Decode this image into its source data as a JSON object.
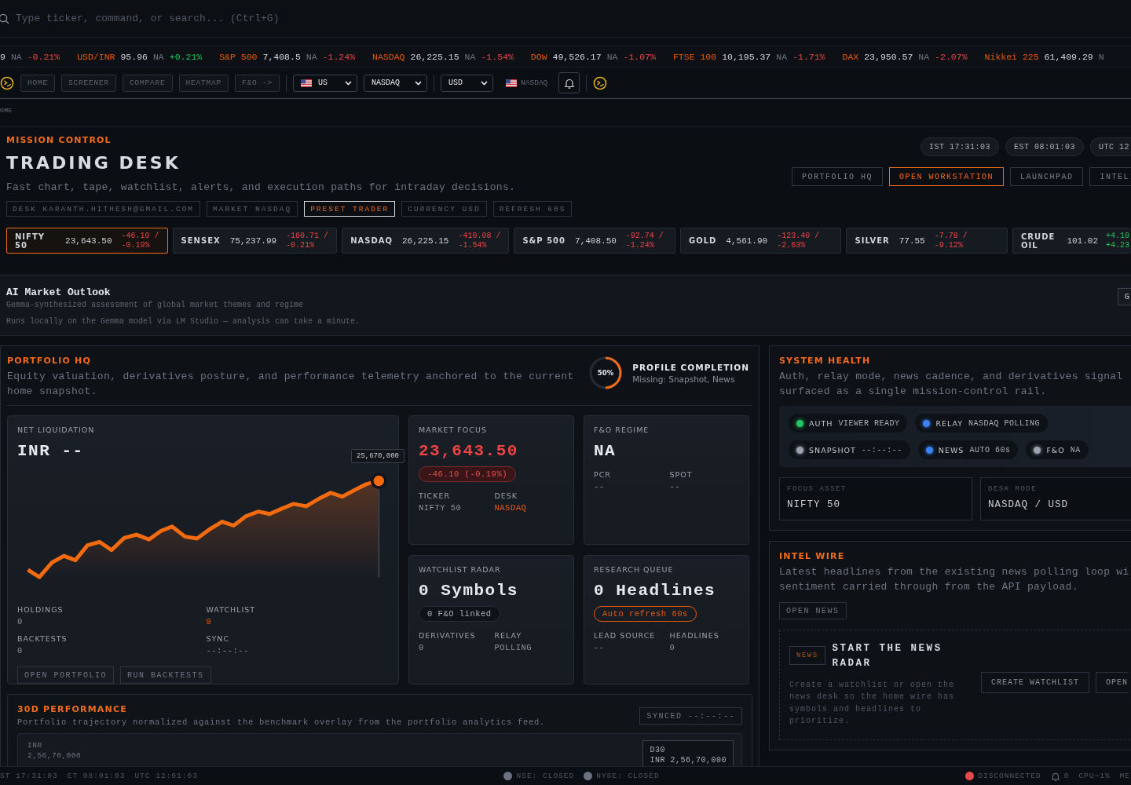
{
  "search": {
    "placeholder": "Type ticker, command, or search... (Ctrl+G)"
  },
  "ticker_tape": [
    {
      "price": "9",
      "source": "NA",
      "change": "-0.21%",
      "negative": true
    },
    {
      "symbol": "USD/INR",
      "price": "95.96",
      "source": "NA",
      "change": "+0.21%",
      "negative": false
    },
    {
      "symbol": "S&P 500",
      "price": "7,408.5",
      "source": "NA",
      "change": "-1.24%",
      "negative": true
    },
    {
      "symbol": "NASDAQ",
      "price": "26,225.15",
      "source": "NA",
      "change": "-1.54%",
      "negative": true
    },
    {
      "symbol": "DOW",
      "price": "49,526.17",
      "source": "NA",
      "change": "-1.07%",
      "negative": true
    },
    {
      "symbol": "FTSE 100",
      "price": "10,195.37",
      "source": "NA",
      "change": "-1.71%",
      "negative": true
    },
    {
      "symbol": "DAX",
      "price": "23,950.57",
      "source": "NA",
      "change": "-2.07%",
      "negative": true
    },
    {
      "symbol": "Nikkei 225",
      "price": "61,409.29",
      "source": "N"
    }
  ],
  "nav": {
    "buttons": [
      "HOME",
      "SCREENER",
      "COMPARE",
      "HEATMAP",
      "F&O ->"
    ],
    "region_select": "US",
    "exchange_select": "NASDAQ",
    "currency_select": "USD",
    "market_chip": "NASDAQ"
  },
  "breadcrumb": "OME",
  "header": {
    "eyebrow": "MISSION CONTROL",
    "title": "TRADING DESK",
    "subtitle": "Fast chart, tape, watchlist, alerts, and execution paths for intraday decisions.",
    "chips": [
      {
        "label": "DESK KARANTH.HITHESH@GMAIL.COM",
        "selected": false
      },
      {
        "label": "MARKET NASDAQ",
        "selected": false
      },
      {
        "label": "PRESET TRADER",
        "selected": true
      },
      {
        "label": "CURRENCY USD",
        "selected": false
      },
      {
        "label": "REFRESH 60S",
        "selected": false
      }
    ],
    "clocks": [
      "IST 17:31:03",
      "EST 08:01:03",
      "UTC 12"
    ],
    "links": [
      {
        "label": "PORTFOLIO HQ",
        "selected": false
      },
      {
        "label": "OPEN WORKSTATION",
        "selected": true
      },
      {
        "label": "LAUNCHPAD",
        "selected": false
      },
      {
        "label": "INTEL",
        "selected": false
      }
    ],
    "indices": [
      {
        "name": "NIFTY 50",
        "price": "23,643.50",
        "change": "-46.10 /",
        "percent": "-0.19%",
        "negative": true,
        "selected": true
      },
      {
        "name": "SENSEX",
        "price": "75,237.99",
        "change": "-160.71 /",
        "percent": "-0.21%",
        "negative": true,
        "selected": false
      },
      {
        "name": "NASDAQ",
        "price": "26,225.15",
        "change": "-410.08 /",
        "percent": "-1.54%",
        "negative": true,
        "selected": false
      },
      {
        "name": "S&P 500",
        "price": "7,408.50",
        "change": "-92.74 /",
        "percent": "-1.24%",
        "negative": true,
        "selected": false
      },
      {
        "name": "GOLD",
        "price": "4,561.90",
        "change": "-123.40 /",
        "percent": "-2.63%",
        "negative": true,
        "selected": false
      },
      {
        "name": "SILVER",
        "price": "77.55",
        "change": "-7.78 /",
        "percent": "-9.12%",
        "negative": true,
        "selected": false
      },
      {
        "name": "CRUDE OIL",
        "price": "101.02",
        "change": "+4.10",
        "percent": "+4.23",
        "negative": false,
        "selected": false
      }
    ]
  },
  "outlook": {
    "title": "AI Market Outlook",
    "subtitle": "Gemma-synthesized assessment of global market themes and regime",
    "note": "Runs locally on the Gemma model via LM Studio — analysis can take a minute.",
    "button": "G"
  },
  "portfolio": {
    "eyebrow": "PORTFOLIO HQ",
    "description": "Equity valuation, derivatives posture, and performance telemetry anchored to the current\nhome snapshot.",
    "profile": {
      "level": 0.5,
      "percent": "50%",
      "title": "PROFILE COMPLETION",
      "missing": "Missing: Snapshot, News"
    },
    "net_liquidation": {
      "label": "NET LIQUIDATION",
      "value": "INR --",
      "tooltip": "25,670,000",
      "stats": [
        {
          "label": "HOLDINGS",
          "value": "0",
          "accent": false
        },
        {
          "label": "WATCHLIST",
          "value": "0",
          "accent": true
        },
        {
          "label": "BACKTESTS",
          "value": "0",
          "accent": false
        },
        {
          "label": "SYNC",
          "value": "--:--:--",
          "accent": false
        }
      ],
      "buttons": [
        "OPEN PORTFOLIO",
        "RUN BACKTESTS"
      ]
    },
    "cards": [
      {
        "label": "MARKET FOCUS",
        "value": "23,643.50",
        "negative": true,
        "pill": {
          "text": "-46.10 (-0.19%)",
          "kind": "negative"
        },
        "stats": [
          {
            "label": "TICKER",
            "value": "NIFTY 50",
            "accent": false
          },
          {
            "label": "DESK",
            "value": "NASDAQ",
            "accent": true
          }
        ]
      },
      {
        "label": "F&O REGIME",
        "value": "NA",
        "stats": [
          {
            "label": "PCR",
            "value": "--",
            "accent": false
          },
          {
            "label": "SPOT",
            "value": "--",
            "accent": false
          }
        ]
      },
      {
        "label": "WATCHLIST RADAR",
        "value": "0 Symbols",
        "pill": {
          "text": "0 F&O linked",
          "kind": "neutral"
        },
        "stats": [
          {
            "label": "DERIVATIVES",
            "value": "0",
            "accent": false
          },
          {
            "label": "RELAY",
            "value": "POLLING",
            "accent": false
          }
        ]
      },
      {
        "label": "RESEARCH QUEUE",
        "value": "0 Headlines",
        "pill": {
          "text": "Auto refresh 60s",
          "kind": "accent"
        },
        "stats": [
          {
            "label": "LEAD SOURCE",
            "value": "--",
            "accent": false
          },
          {
            "label": "HEADLINES",
            "value": "0",
            "accent": false
          }
        ]
      }
    ],
    "performance": {
      "eyebrow": "30D PERFORMANCE",
      "description": "Portfolio trajectory normalized against the benchmark overlay from the portfolio analytics feed.",
      "synced": "SYNCED --:--:--",
      "axis_label": "INR",
      "axis_value": "2,56,70,000",
      "tag_title": "D30",
      "tag_value": "INR 2,56,70,000"
    }
  },
  "system_health": {
    "eyebrow": "SYSTEM HEALTH",
    "description": "Auth, relay mode, news cadence, and derivatives signal\nsurfaced as a single mission-control rail.",
    "pills": [
      {
        "label": "AUTH",
        "value": "VIEWER READY",
        "color": "#22c55e"
      },
      {
        "label": "RELAY",
        "value": "NASDAQ POLLING",
        "color": "#3b82f6"
      },
      {
        "label": "SNAPSHOT",
        "value": "--:--:--",
        "color": "#9ca3af"
      },
      {
        "label": "NEWS",
        "value": "AUTO 60s",
        "color": "#3b82f6"
      },
      {
        "label": "F&O",
        "value": "NA",
        "color": "#9ca3af"
      }
    ],
    "fields": [
      {
        "label": "FOCUS ASSET",
        "value": "NIFTY 50"
      },
      {
        "label": "DESK MODE",
        "value": "NASDAQ / USD"
      }
    ]
  },
  "intel_wire": {
    "eyebrow": "INTEL WIRE",
    "description": "Latest headlines from the existing news polling loop wi\nsentiment carried through from the API payload.",
    "button": "OPEN NEWS",
    "empty_state": {
      "tag": "NEWS",
      "title": "START THE NEWS\nRADAR",
      "body": "Create a watchlist or open the\nnews desk so the home wire has\nsymbols and headlines to\nprioritize.",
      "buttons": [
        "CREATE WATCHLIST",
        "OPEN"
      ]
    }
  },
  "status_bar": {
    "clocks": [
      "ST 17:31:03",
      "ET 08:01:03",
      "UTC 12:01:03"
    ],
    "markets": [
      {
        "label": "NSE: CLOSED",
        "color": "#6b7280"
      },
      {
        "label": "NYSE: CLOSED",
        "color": "#6b7280"
      }
    ],
    "connection": {
      "label": "DISCONNECTED",
      "color": "#e5484d"
    },
    "alerts": "0",
    "cpu": "CPU~1%",
    "extra": "ME"
  }
}
